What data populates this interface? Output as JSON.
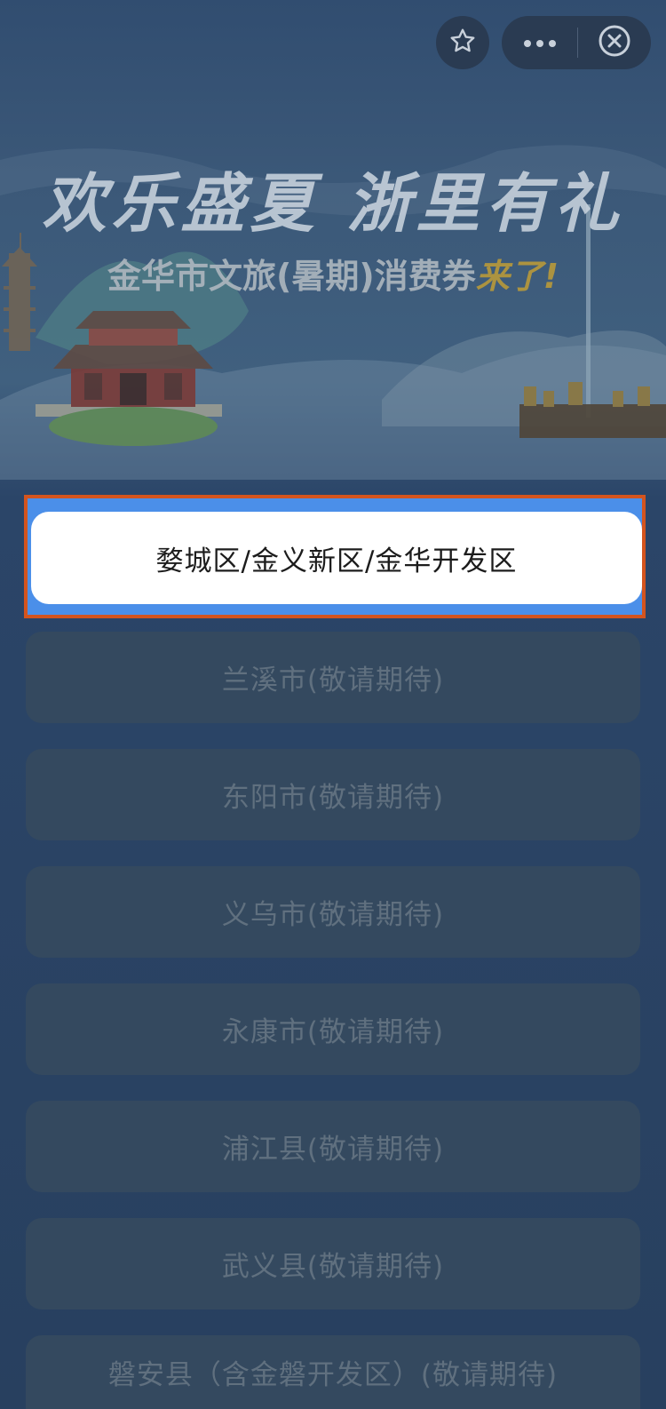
{
  "capsule": {
    "favorite_icon": "star-icon",
    "more_icon": "more-dots-icon",
    "close_icon": "close-circle-icon"
  },
  "banner": {
    "slogan": "欢乐盛夏 浙里有礼",
    "subtitle_main": "金华市文旅(暑期)消费券",
    "subtitle_accent": "来了!"
  },
  "regions": {
    "active": "婺城区/金义新区/金华开发区",
    "items": [
      "兰溪市(敬请期待)",
      "东阳市(敬请期待)",
      "义乌市(敬请期待)",
      "永康市(敬请期待)",
      "浦江县(敬请期待)",
      "武义县(敬请期待)",
      "磐安县（含金磐开发区）(敬请期待)"
    ]
  },
  "colors": {
    "background": "#2b4568",
    "active_button": "#ffffff",
    "active_highlight_border": "#d4541e",
    "active_strip": "#4b8fe9",
    "disabled_button": "#34495f"
  }
}
